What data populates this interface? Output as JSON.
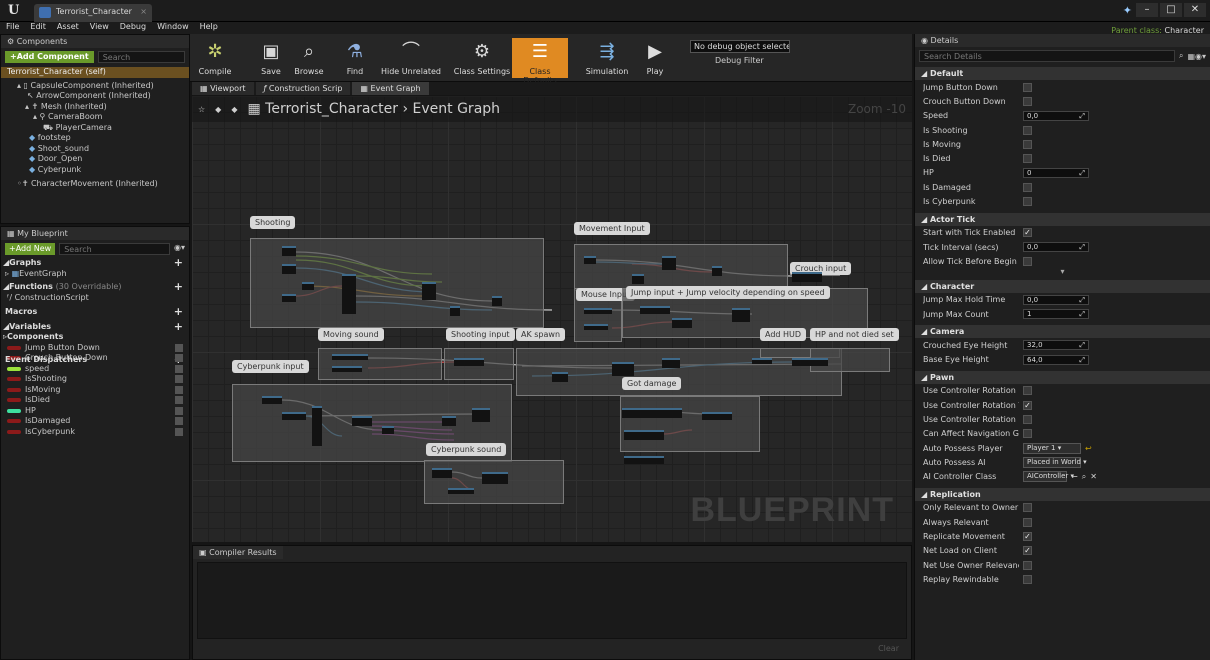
{
  "app": {
    "tab_title": "Terrorist_Character",
    "parent_class_label": "Parent class:",
    "parent_class": "Character"
  },
  "menu": [
    "File",
    "Edit",
    "Asset",
    "View",
    "Debug",
    "Window",
    "Help"
  ],
  "components": {
    "header": "Components",
    "add_button": "+Add Component",
    "search_placeholder": "Search",
    "self": "Terrorist_Character (self)",
    "tree": [
      "CapsuleComponent (Inherited)",
      "ArrowComponent (Inherited)",
      "Mesh (Inherited)",
      "CameraBoom",
      "PlayerCamera",
      "footstep",
      "Shoot_sound",
      "Door_Open",
      "Cyberpunk",
      "CharacterMovement (Inherited)"
    ]
  },
  "my_blueprint": {
    "header": "My Blueprint",
    "add_button": "+Add New",
    "search_placeholder": "Search",
    "graphs": "Graphs",
    "event_graph": "EventGraph",
    "functions": "Functions",
    "functions_note": "(30 Overridable)",
    "construction": "ConstructionScript",
    "macros": "Macros",
    "variables": "Variables",
    "components": "Components",
    "dispatchers": "Event Dispatchers",
    "vars": [
      {
        "name": "Jump Button Down",
        "color": "#8c1a1a"
      },
      {
        "name": "Crouch Button Down",
        "color": "#8c1a1a"
      },
      {
        "name": "speed",
        "color": "#9be23c"
      },
      {
        "name": "IsShooting",
        "color": "#8c1a1a"
      },
      {
        "name": "IsMoving",
        "color": "#8c1a1a"
      },
      {
        "name": "IsDied",
        "color": "#8c1a1a"
      },
      {
        "name": "HP",
        "color": "#3ee0a0"
      },
      {
        "name": "IsDamaged",
        "color": "#8c1a1a"
      },
      {
        "name": "IsCyberpunk",
        "color": "#8c1a1a"
      }
    ]
  },
  "toolbar": {
    "compile": "Compile",
    "save": "Save",
    "browse": "Browse",
    "find": "Find",
    "hide": "Hide Unrelated",
    "class_settings": "Class Settings",
    "class_defaults": "Class Defaults",
    "simulation": "Simulation",
    "play": "Play",
    "debug_select": "No debug object selected ▾",
    "debug_filter": "Debug Filter"
  },
  "graph": {
    "tabs": [
      "Viewport",
      "Construction Scrip",
      "Event Graph"
    ],
    "breadcrumb_a": "Terrorist_Character",
    "breadcrumb_b": "Event Graph",
    "zoom": "Zoom -10",
    "watermark": "BLUEPRINT",
    "comments": [
      "Shooting",
      "Movement Input",
      "Crouch input",
      "Mouse Input",
      "Jump input + Jump velocity depending on speed",
      "Moving sound",
      "Shooting input",
      "AK spawn",
      "Add HUD",
      "HP and not died set",
      "Cyberpunk input",
      "Got damage",
      "Cyberpunk sound"
    ]
  },
  "compiler": {
    "header": "Compiler Results",
    "clear": "Clear"
  },
  "details": {
    "header": "Details",
    "search_placeholder": "Search Details",
    "sections": {
      "default": "Default",
      "actor_tick": "Actor Tick",
      "character": "Character",
      "camera": "Camera",
      "pawn": "Pawn",
      "replication": "Replication"
    },
    "default_rows": [
      "Jump Button Down",
      "Crouch Button Down",
      "Speed",
      "Is Shooting",
      "Is Moving",
      "Is Died",
      "HP",
      "Is Damaged",
      "Is Cyberpunk"
    ],
    "speed": "0,0",
    "hp": "0",
    "tick_rows": [
      "Start with Tick Enabled",
      "Tick Interval (secs)",
      "Allow Tick Before Begin Play"
    ],
    "tick_interval": "0,0",
    "char_rows": [
      "Jump Max Hold Time",
      "Jump Max Count"
    ],
    "jump_hold": "0,0",
    "jump_count": "1",
    "cam_rows": [
      "Crouched Eye Height",
      "Base Eye Height"
    ],
    "crouched_eye": "32,0",
    "base_eye": "64,0",
    "pawn_rows": [
      "Use Controller Rotation Pitch",
      "Use Controller Rotation Yaw",
      "Use Controller Rotation Roll",
      "Can Affect Navigation Generi",
      "Auto Possess Player",
      "Auto Possess AI",
      "AI Controller Class"
    ],
    "auto_player": "Player 1",
    "auto_ai": "Placed in World",
    "ai_class": "AIController",
    "rep_rows": [
      "Only Relevant to Owner",
      "Always Relevant",
      "Replicate Movement",
      "Net Load on Client",
      "Net Use Owner Relevancy",
      "Replay Rewindable"
    ]
  }
}
